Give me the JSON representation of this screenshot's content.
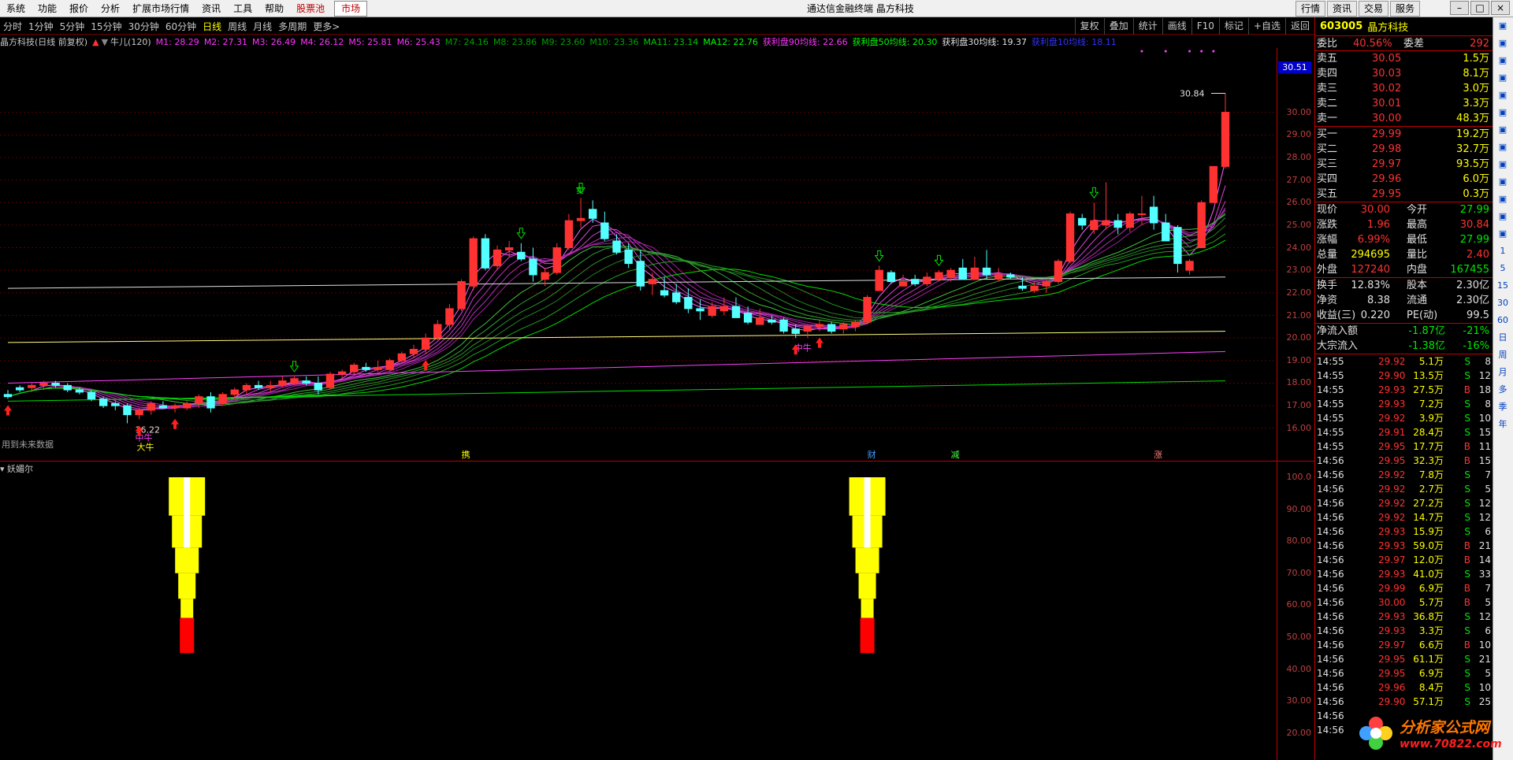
{
  "menu": {
    "items": [
      "系统",
      "功能",
      "报价",
      "分析",
      "扩展市场行情",
      "资讯",
      "工具",
      "帮助"
    ],
    "pool": "股票池",
    "market": "市场",
    "title": "通达信金融终端  晶方科技",
    "right_buttons": [
      "行情",
      "资讯",
      "交易",
      "服务"
    ]
  },
  "periods": [
    "分时",
    "1分钟",
    "5分钟",
    "15分钟",
    "30分钟",
    "60分钟",
    "日线",
    "周线",
    "月线",
    "多周期",
    "更多>"
  ],
  "active_period": "日线",
  "toolbar": [
    "复权",
    "叠加",
    "统计",
    "画线",
    "F10",
    "标记",
    "+自选",
    "返回"
  ],
  "header": {
    "stock": "晶方科技(日线 前复权)",
    "indicator": "牛儿(120)"
  },
  "ma_labels": [
    {
      "text": "M1: 28.29",
      "color": "#ff32ff"
    },
    {
      "text": "M2: 27.31",
      "color": "#ff32ff"
    },
    {
      "text": "M3: 26.49",
      "color": "#ff32ff"
    },
    {
      "text": "M4: 26.12",
      "color": "#ff32ff"
    },
    {
      "text": "M5: 25.81",
      "color": "#ff32ff"
    },
    {
      "text": "M6: 25.43",
      "color": "#ff32ff"
    },
    {
      "text": "M7: 24.16",
      "color": "#00a000"
    },
    {
      "text": "M8: 23.86",
      "color": "#00a000"
    },
    {
      "text": "M9: 23.60",
      "color": "#00a000"
    },
    {
      "text": "M10: 23.36",
      "color": "#00a000"
    },
    {
      "text": "MA11: 23.14",
      "color": "#00c800"
    },
    {
      "text": "MA12: 22.76",
      "color": "#00ff00"
    },
    {
      "text": "获利盘90均线: 22.66",
      "color": "#ff32ff"
    },
    {
      "text": "获利盘50均线: 20.30",
      "color": "#00ff00"
    },
    {
      "text": "获利盘30均线: 19.37",
      "color": "#e0e0e0"
    },
    {
      "text": "获利盘10均线: 18.11",
      "color": "#3232ff"
    }
  ],
  "price_axis": [
    "30.00",
    "29.00",
    "28.00",
    "27.00",
    "26.00",
    "25.00",
    "24.00",
    "23.00",
    "22.00",
    "21.00",
    "20.00",
    "19.00",
    "18.00",
    "17.00",
    "16.00"
  ],
  "current_price_tag": "30.51",
  "annotations": {
    "high": "30.84",
    "low": "16.22",
    "big_bull": "大牛",
    "mid_bull": "中牛",
    "mid_bull2": "中牛",
    "future_note": "用到未来数据",
    "events": [
      "携",
      "财",
      "减",
      "涨"
    ],
    "top_mark": "卖"
  },
  "sub": {
    "title": "妖媚尔",
    "axis": [
      "100.0",
      "90.00",
      "80.00",
      "70.00",
      "60.00",
      "50.00",
      "40.00",
      "30.00",
      "20.00"
    ]
  },
  "quote": {
    "code": "603005",
    "name": "晶方科技",
    "webi": {
      "label": "委比",
      "value": "40.56%",
      "label2": "委差",
      "value2": "292"
    },
    "asks": [
      {
        "label": "卖五",
        "price": "30.05",
        "vol": "1.5万"
      },
      {
        "label": "卖四",
        "price": "30.03",
        "vol": "8.1万"
      },
      {
        "label": "卖三",
        "price": "30.02",
        "vol": "3.0万"
      },
      {
        "label": "卖二",
        "price": "30.01",
        "vol": "3.3万"
      },
      {
        "label": "卖一",
        "price": "30.00",
        "vol": "48.3万"
      }
    ],
    "bids": [
      {
        "label": "买一",
        "price": "29.99",
        "vol": "19.2万"
      },
      {
        "label": "买二",
        "price": "29.98",
        "vol": "32.7万"
      },
      {
        "label": "买三",
        "price": "29.97",
        "vol": "93.5万"
      },
      {
        "label": "买四",
        "price": "29.96",
        "vol": "6.0万"
      },
      {
        "label": "买五",
        "price": "29.95",
        "vol": "0.3万"
      }
    ],
    "stats": [
      {
        "l1": "现价",
        "v1": "30.00",
        "c1": "red",
        "l2": "今开",
        "v2": "27.99",
        "c2": "green"
      },
      {
        "l1": "涨跌",
        "v1": "1.96",
        "c1": "red",
        "l2": "最高",
        "v2": "30.84",
        "c2": "red"
      },
      {
        "l1": "涨幅",
        "v1": "6.99%",
        "c1": "red",
        "l2": "最低",
        "v2": "27.99",
        "c2": "green"
      },
      {
        "l1": "总量",
        "v1": "294695",
        "c1": "yellow",
        "l2": "量比",
        "v2": "2.40",
        "c2": "red"
      },
      {
        "l1": "外盘",
        "v1": "127240",
        "c1": "red",
        "l2": "内盘",
        "v2": "167455",
        "c2": "green"
      }
    ],
    "stats2": [
      {
        "l1": "换手",
        "v1": "12.83%",
        "l2": "股本",
        "v2": "2.30亿"
      },
      {
        "l1": "净资",
        "v1": "8.38",
        "l2": "流通",
        "v2": "2.30亿"
      },
      {
        "l1": "收益(三)",
        "v1": "0.220",
        "l2": "PE(动)",
        "v2": "99.5"
      }
    ],
    "flows": [
      {
        "label": "净流入额",
        "value": "-1.87亿",
        "pct": "-21%"
      },
      {
        "label": "大宗流入",
        "value": "-1.38亿",
        "pct": "-16%"
      }
    ],
    "ticks": [
      [
        "14:55",
        "29.92",
        "5.1万",
        "S",
        "8"
      ],
      [
        "14:55",
        "29.90",
        "13.5万",
        "S",
        "12"
      ],
      [
        "14:55",
        "29.93",
        "27.5万",
        "B",
        "18"
      ],
      [
        "14:55",
        "29.93",
        "7.2万",
        "S",
        "8"
      ],
      [
        "14:55",
        "29.92",
        "3.9万",
        "S",
        "10"
      ],
      [
        "14:55",
        "29.91",
        "28.4万",
        "S",
        "15"
      ],
      [
        "14:55",
        "29.95",
        "17.7万",
        "B",
        "11"
      ],
      [
        "14:56",
        "29.95",
        "32.3万",
        "B",
        "15"
      ],
      [
        "14:56",
        "29.92",
        "7.8万",
        "S",
        "7"
      ],
      [
        "14:56",
        "29.92",
        "2.7万",
        "S",
        "5"
      ],
      [
        "14:56",
        "29.92",
        "27.2万",
        "S",
        "12"
      ],
      [
        "14:56",
        "29.92",
        "14.7万",
        "S",
        "12"
      ],
      [
        "14:56",
        "29.93",
        "15.9万",
        "S",
        "6"
      ],
      [
        "14:56",
        "29.93",
        "59.0万",
        "B",
        "21"
      ],
      [
        "14:56",
        "29.97",
        "12.0万",
        "B",
        "14"
      ],
      [
        "14:56",
        "29.93",
        "41.0万",
        "S",
        "33"
      ],
      [
        "14:56",
        "29.99",
        "6.9万",
        "B",
        "7"
      ],
      [
        "14:56",
        "30.00",
        "5.7万",
        "B",
        "5"
      ],
      [
        "14:56",
        "29.93",
        "36.8万",
        "S",
        "12"
      ],
      [
        "14:56",
        "29.93",
        "3.3万",
        "S",
        "6"
      ],
      [
        "14:56",
        "29.97",
        "6.6万",
        "B",
        "10"
      ],
      [
        "14:56",
        "29.95",
        "61.1万",
        "S",
        "21"
      ],
      [
        "14:56",
        "29.95",
        "6.9万",
        "S",
        "5"
      ],
      [
        "14:56",
        "29.96",
        "8.4万",
        "S",
        "10"
      ],
      [
        "14:56",
        "29.90",
        "57.1万",
        "S",
        "25"
      ],
      [
        "14:56",
        "",
        "",
        "",
        ""
      ],
      [
        "14:56",
        "",
        "",
        "",
        ""
      ]
    ]
  },
  "sidebar": [
    "1",
    "5",
    "15",
    "30",
    "60",
    "日",
    "周",
    "月",
    "多",
    "季",
    "年"
  ],
  "watermark": {
    "title": "分析家公式网",
    "url": "www.70822.com"
  },
  "chart_data": {
    "type": "candlestick",
    "price_range": [
      15.4,
      31.8
    ],
    "candles": [
      [
        17.5,
        17.7,
        17.3,
        17.4
      ],
      [
        17.8,
        17.9,
        17.6,
        17.7
      ],
      [
        17.8,
        18.0,
        17.6,
        17.9
      ],
      [
        17.9,
        18.1,
        17.7,
        18.0
      ],
      [
        18.0,
        18.1,
        17.8,
        17.9
      ],
      [
        17.9,
        18.0,
        17.6,
        17.7
      ],
      [
        17.7,
        17.8,
        17.5,
        17.6
      ],
      [
        17.6,
        17.7,
        17.2,
        17.3
      ],
      [
        17.3,
        17.4,
        16.9,
        17.0
      ],
      [
        17.1,
        17.2,
        16.8,
        17.0
      ],
      [
        17.0,
        17.1,
        16.22,
        16.6
      ],
      [
        16.6,
        16.9,
        16.4,
        16.8
      ],
      [
        16.8,
        17.2,
        16.6,
        17.1
      ],
      [
        17.0,
        17.2,
        16.9,
        16.9
      ],
      [
        16.9,
        17.1,
        16.7,
        17.0
      ],
      [
        16.9,
        17.2,
        16.8,
        17.1
      ],
      [
        17.1,
        17.5,
        16.9,
        17.4
      ],
      [
        17.4,
        17.6,
        16.7,
        16.9
      ],
      [
        17.1,
        17.6,
        17.0,
        17.5
      ],
      [
        17.5,
        17.8,
        17.3,
        17.7
      ],
      [
        17.7,
        18.0,
        17.5,
        17.9
      ],
      [
        17.9,
        18.1,
        17.7,
        17.8
      ],
      [
        17.8,
        18.1,
        17.6,
        17.9
      ],
      [
        17.9,
        18.3,
        17.8,
        18.1
      ],
      [
        18.0,
        18.3,
        17.9,
        18.2
      ],
      [
        18.1,
        18.3,
        17.9,
        18.0
      ],
      [
        18.0,
        18.3,
        17.5,
        17.7
      ],
      [
        17.8,
        18.5,
        17.7,
        18.4
      ],
      [
        18.4,
        18.6,
        18.2,
        18.5
      ],
      [
        18.5,
        18.9,
        18.4,
        18.8
      ],
      [
        18.7,
        18.9,
        18.5,
        18.6
      ],
      [
        18.6,
        19.0,
        18.5,
        18.7
      ],
      [
        18.6,
        19.1,
        18.5,
        19.0
      ],
      [
        19.0,
        19.4,
        18.9,
        19.3
      ],
      [
        19.3,
        19.7,
        19.1,
        19.5
      ],
      [
        19.5,
        20.2,
        19.3,
        20.0
      ],
      [
        20.0,
        20.8,
        19.9,
        20.6
      ],
      [
        20.6,
        21.5,
        20.4,
        21.3
      ],
      [
        21.3,
        22.6,
        21.2,
        22.5
      ],
      [
        22.3,
        24.5,
        22.1,
        24.4
      ],
      [
        24.4,
        24.6,
        23.0,
        23.1
      ],
      [
        23.2,
        24.1,
        23.0,
        23.9
      ],
      [
        23.9,
        24.3,
        23.6,
        24.0
      ],
      [
        23.8,
        24.2,
        23.4,
        23.5
      ],
      [
        23.5,
        24.0,
        22.5,
        22.8
      ],
      [
        22.6,
        23.1,
        22.3,
        22.9
      ],
      [
        22.9,
        24.2,
        22.8,
        24.0
      ],
      [
        24.0,
        25.5,
        23.9,
        25.2
      ],
      [
        25.2,
        26.2,
        24.9,
        25.3
      ],
      [
        25.7,
        26.1,
        25.1,
        25.3
      ],
      [
        25.1,
        25.6,
        24.3,
        24.4
      ],
      [
        24.3,
        24.6,
        23.7,
        23.8
      ],
      [
        23.9,
        24.2,
        23.1,
        23.3
      ],
      [
        23.4,
        23.9,
        22.1,
        22.3
      ],
      [
        22.4,
        22.9,
        21.9,
        22.6
      ],
      [
        22.1,
        22.7,
        21.8,
        21.9
      ],
      [
        22.0,
        22.4,
        21.5,
        21.6
      ],
      [
        21.8,
        22.2,
        21.1,
        21.3
      ],
      [
        21.3,
        21.7,
        20.8,
        21.2
      ],
      [
        21.0,
        21.6,
        20.9,
        21.4
      ],
      [
        21.2,
        21.8,
        21.0,
        21.4
      ],
      [
        21.4,
        21.8,
        20.9,
        20.9
      ],
      [
        21.1,
        21.4,
        20.6,
        20.7
      ],
      [
        20.6,
        21.3,
        20.6,
        20.9
      ],
      [
        20.8,
        21.0,
        20.6,
        20.7
      ],
      [
        20.8,
        20.9,
        20.2,
        20.3
      ],
      [
        20.4,
        20.6,
        20.0,
        20.2
      ],
      [
        20.3,
        20.6,
        20.0,
        20.5
      ],
      [
        20.5,
        20.8,
        20.3,
        20.6
      ],
      [
        20.6,
        20.7,
        20.2,
        20.3
      ],
      [
        20.4,
        20.7,
        20.2,
        20.6
      ],
      [
        20.5,
        20.8,
        20.3,
        20.7
      ],
      [
        20.7,
        21.9,
        20.6,
        21.8
      ],
      [
        22.1,
        23.2,
        22.1,
        23.0
      ],
      [
        22.9,
        23.0,
        22.4,
        22.5
      ],
      [
        22.3,
        22.8,
        22.3,
        22.5
      ],
      [
        22.6,
        22.8,
        22.3,
        22.4
      ],
      [
        22.4,
        22.9,
        22.3,
        22.7
      ],
      [
        22.6,
        23.0,
        22.5,
        22.9
      ],
      [
        22.7,
        23.1,
        22.5,
        23.0
      ],
      [
        23.1,
        23.5,
        22.6,
        22.6
      ],
      [
        22.6,
        23.6,
        22.6,
        23.1
      ],
      [
        23.1,
        23.9,
        22.6,
        22.8
      ],
      [
        22.6,
        23.1,
        22.5,
        22.8
      ],
      [
        22.8,
        22.9,
        22.6,
        22.7
      ],
      [
        22.3,
        22.7,
        22.1,
        22.2
      ],
      [
        22.1,
        22.5,
        22.0,
        22.3
      ],
      [
        22.3,
        22.6,
        22.0,
        22.5
      ],
      [
        22.5,
        23.5,
        22.4,
        23.4
      ],
      [
        23.4,
        25.6,
        23.3,
        25.5
      ],
      [
        25.3,
        25.5,
        24.8,
        25.0
      ],
      [
        24.8,
        26.0,
        24.6,
        25.2
      ],
      [
        25.0,
        26.9,
        24.8,
        25.2
      ],
      [
        25.2,
        25.5,
        24.6,
        24.9
      ],
      [
        24.9,
        25.6,
        24.7,
        25.5
      ],
      [
        25.5,
        26.3,
        25.0,
        25.5
      ],
      [
        25.8,
        26.3,
        24.8,
        25.1
      ],
      [
        25.1,
        25.5,
        24.3,
        24.3
      ],
      [
        24.9,
        25.0,
        22.9,
        23.3
      ],
      [
        23.0,
        23.5,
        22.8,
        23.4
      ],
      [
        24.0,
        26.1,
        24.0,
        26.0
      ],
      [
        26.0,
        27.3,
        26.0,
        27.6
      ],
      [
        27.6,
        30.84,
        27.5,
        30.0
      ]
    ]
  }
}
